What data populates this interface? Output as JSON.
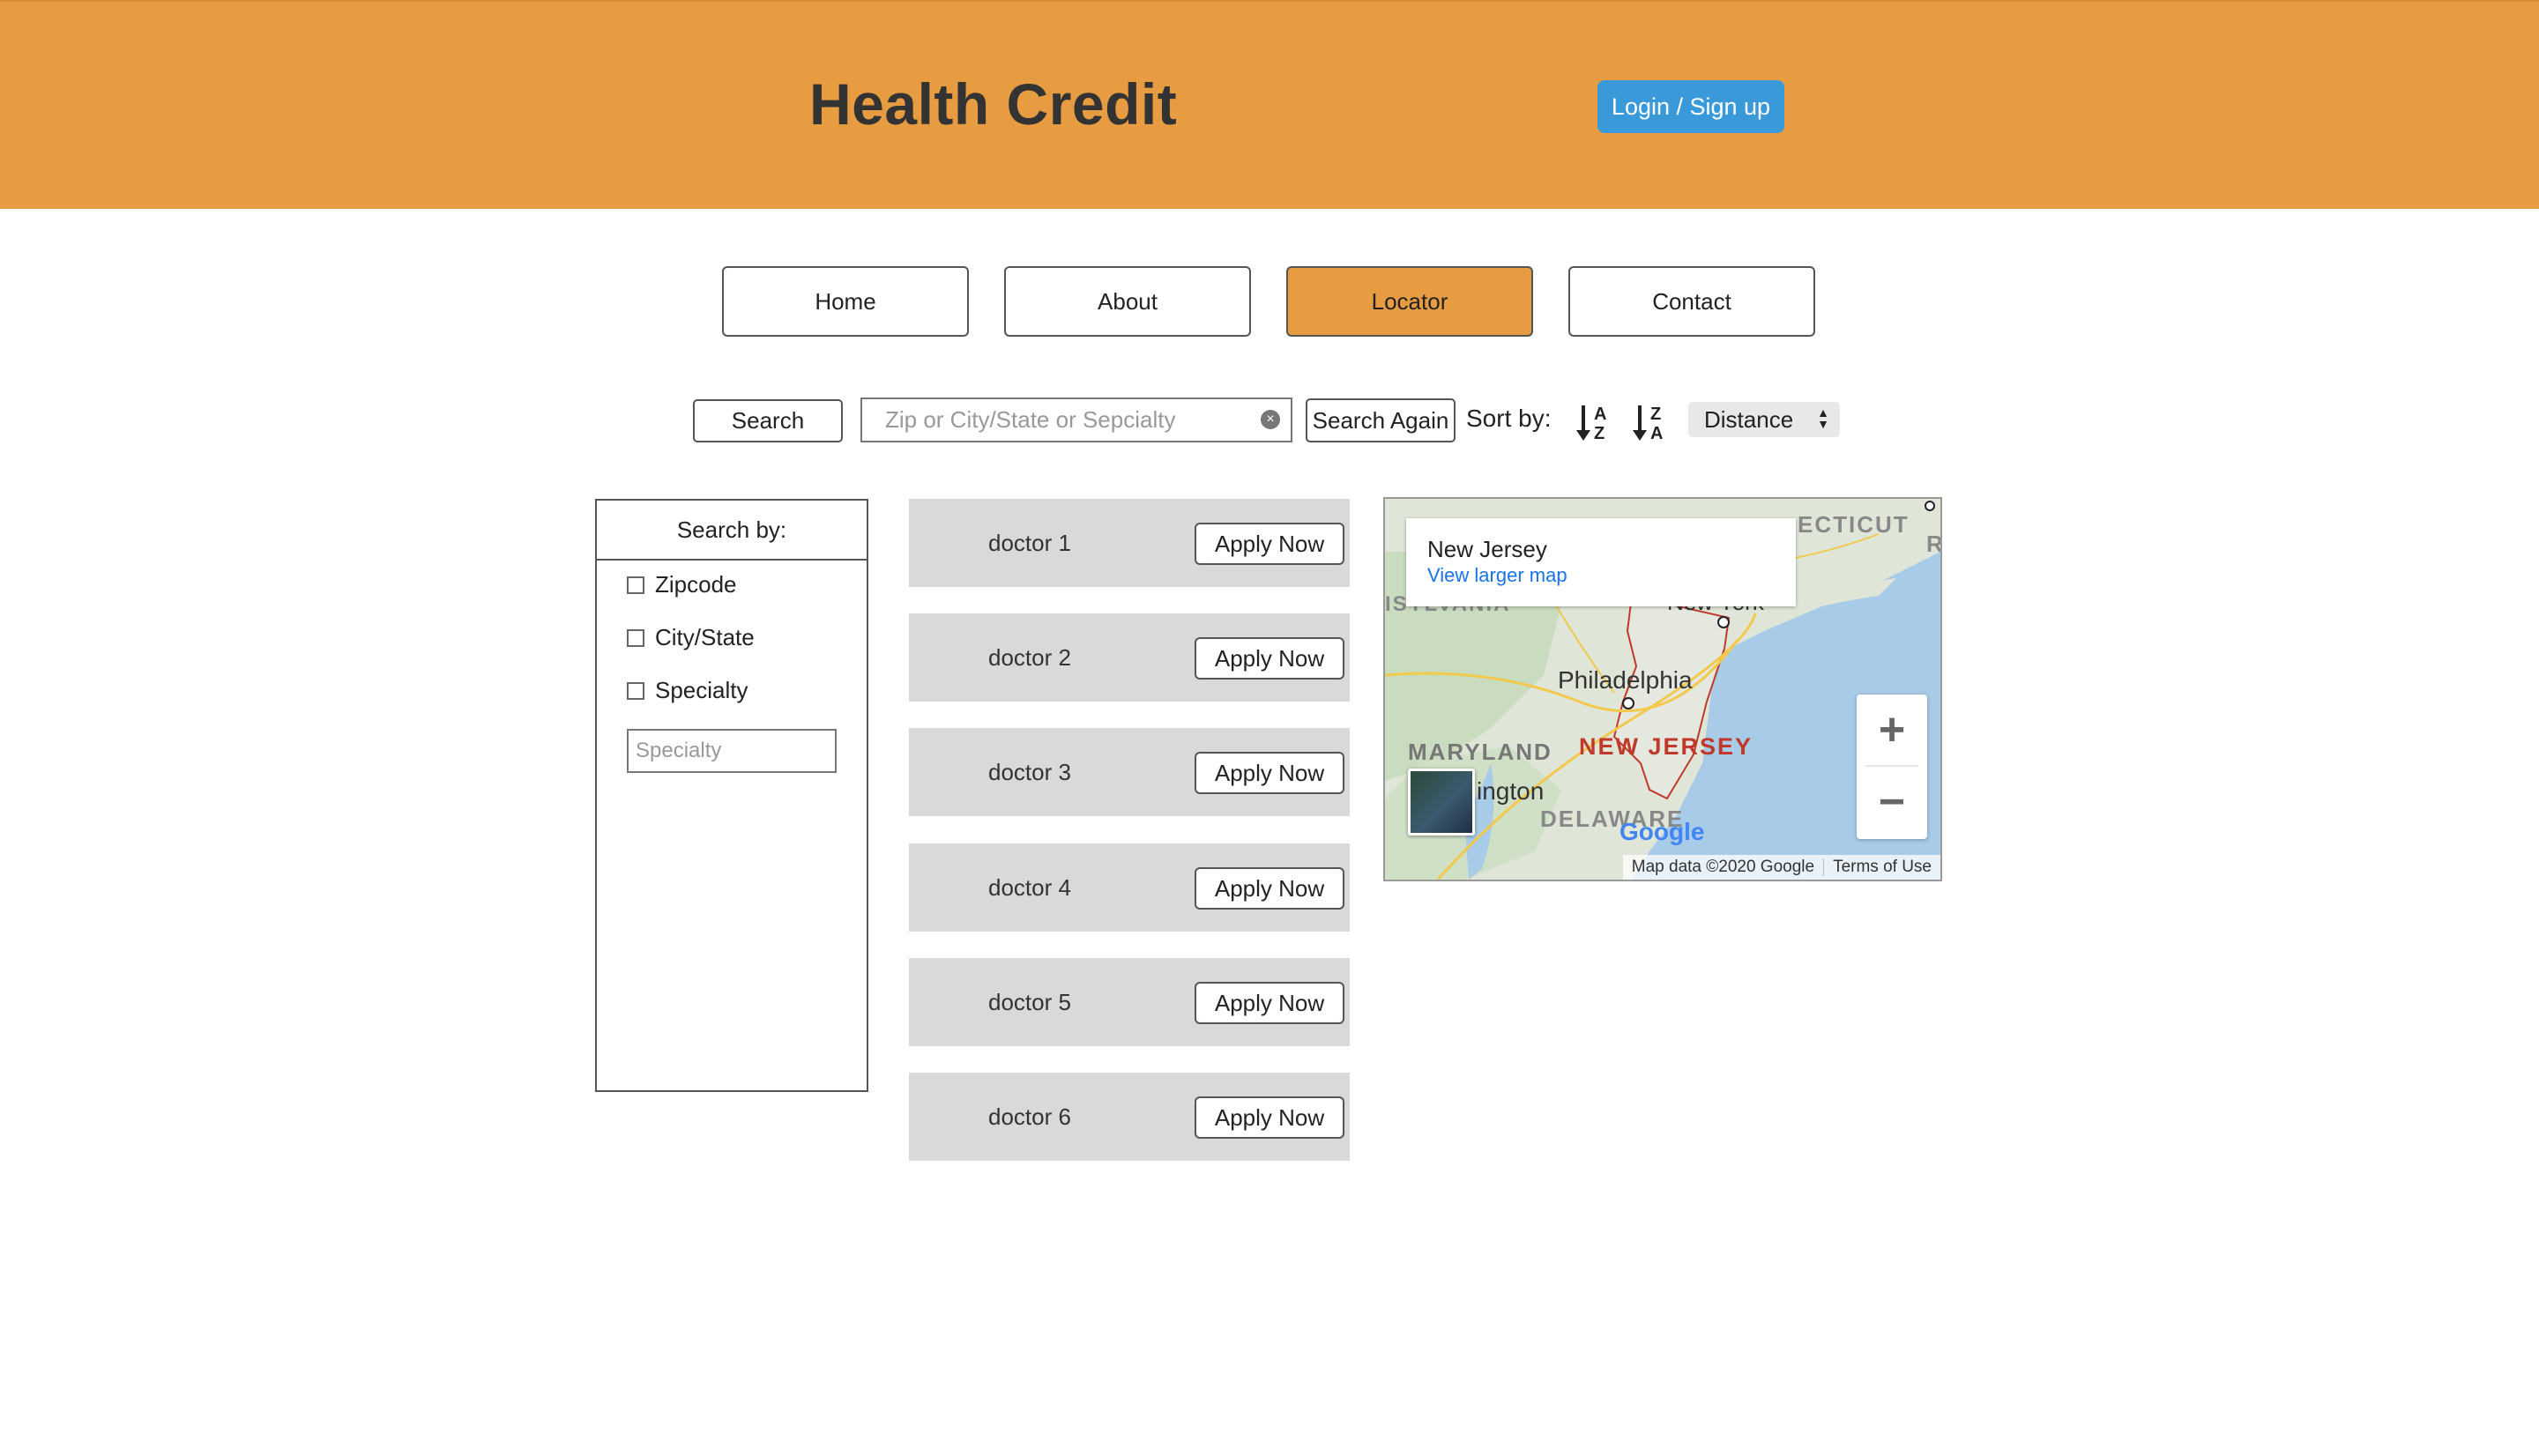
{
  "header": {
    "brand": "Health Credit",
    "login_label": "Login / Sign up"
  },
  "nav": {
    "items": [
      {
        "label": "Home",
        "active": false
      },
      {
        "label": "About",
        "active": false
      },
      {
        "label": "Locator",
        "active": true
      },
      {
        "label": "Contact",
        "active": false
      }
    ]
  },
  "search": {
    "button_label": "Search",
    "placeholder": "Zip or City/State or Sepcialty",
    "value": "",
    "search_again_label": "Search Again",
    "sort_label": "Sort by:",
    "sort_icons": [
      "sort-a-z-icon",
      "sort-z-a-icon"
    ],
    "sort_value": "Distance"
  },
  "filters": {
    "title": "Search by:",
    "options": [
      {
        "label": "Zipcode",
        "checked": false
      },
      {
        "label": "City/State",
        "checked": false
      },
      {
        "label": "Specialty",
        "checked": false
      }
    ],
    "specialty_placeholder": "Specialty"
  },
  "doctors": [
    {
      "name": "doctor 1",
      "action": "Apply Now"
    },
    {
      "name": "doctor 2",
      "action": "Apply Now"
    },
    {
      "name": "doctor 3",
      "action": "Apply Now"
    },
    {
      "name": "doctor 4",
      "action": "Apply Now"
    },
    {
      "name": "doctor 5",
      "action": "Apply Now"
    },
    {
      "name": "doctor 6",
      "action": "Apply Now"
    }
  ],
  "map": {
    "info_title": "New Jersey",
    "info_link": "View larger map",
    "labels": {
      "connecticut": "ECTICUT",
      "r": "R",
      "pennsylvania": "ISYLVANIA",
      "new_york": "New York",
      "philadelphia": "Philadelphia",
      "maryland": "MARYLAND",
      "new_jersey": "NEW JERSEY",
      "washington": "ington",
      "delaware": "DELAWARE",
      "google": "Google"
    },
    "zoom_in": "+",
    "zoom_out": "−",
    "attribution": "Map data ©2020 Google",
    "terms": "Terms of Use"
  },
  "colors": {
    "header": "#e89c41",
    "active_nav": "#e89c41",
    "login_button": "#3a9ad9",
    "doctor_row": "#d9d9d9"
  }
}
